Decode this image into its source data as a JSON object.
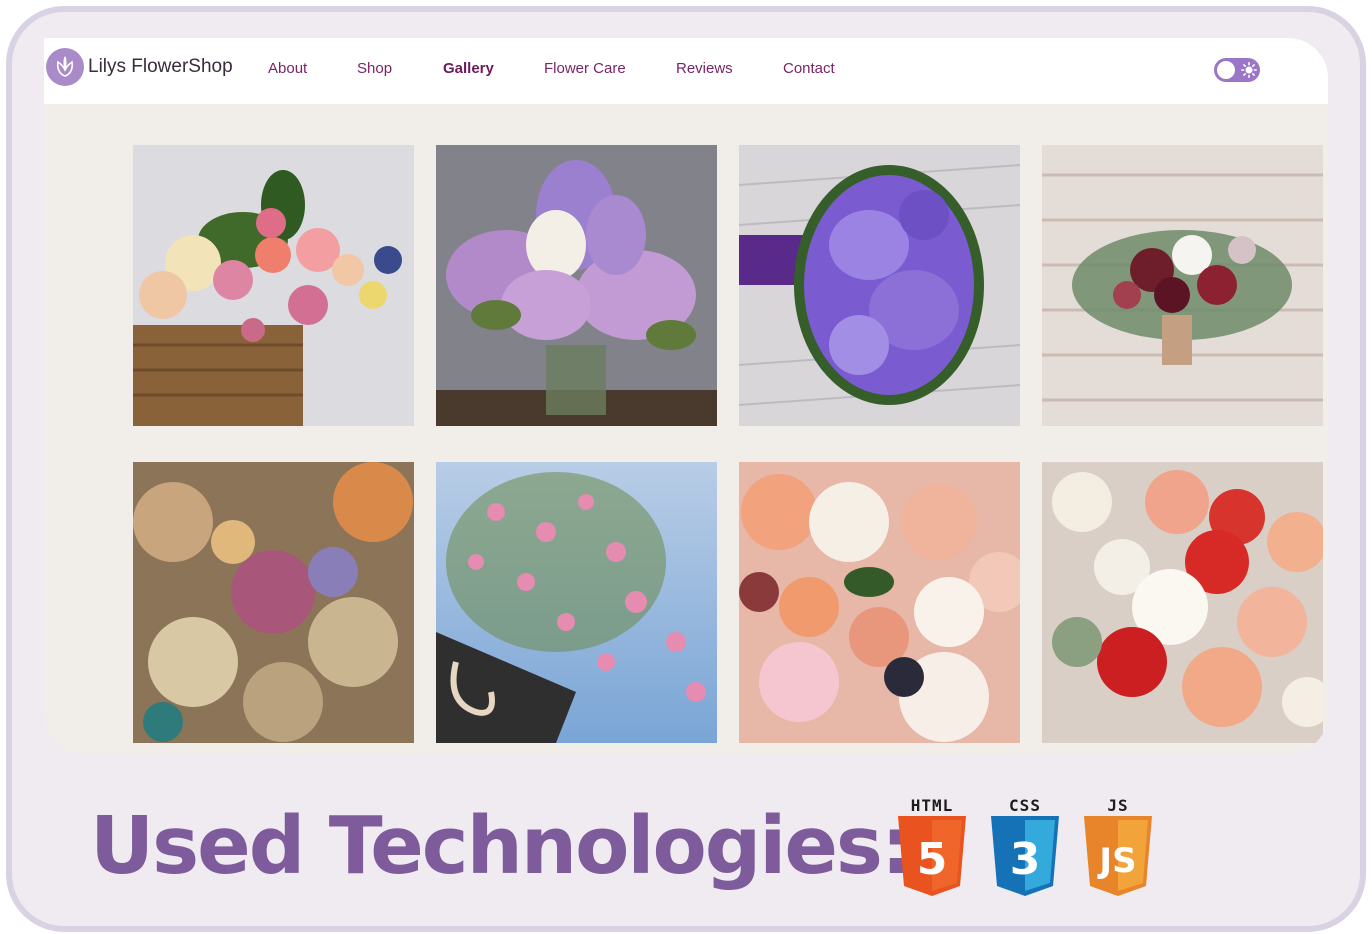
{
  "header": {
    "logo_text": "Lilys FlowerShop",
    "nav": [
      {
        "label": "About"
      },
      {
        "label": "Shop"
      },
      {
        "label": "Gallery",
        "active": true
      },
      {
        "label": "Flower Care"
      },
      {
        "label": "Reviews"
      },
      {
        "label": "Contact"
      }
    ],
    "theme_toggle": {
      "icon": "sun-icon",
      "state": "off"
    }
  },
  "gallery": {
    "images": [
      {
        "name": "rose-basket-image"
      },
      {
        "name": "lilac-vase-image"
      },
      {
        "name": "purple-bouquet-image"
      },
      {
        "name": "burgundy-bouquet-image"
      },
      {
        "name": "dried-flowers-image"
      },
      {
        "name": "gypsophila-bag-image"
      },
      {
        "name": "ranunculus-bouquet-image"
      },
      {
        "name": "red-peony-bouquet-image"
      }
    ]
  },
  "footer": {
    "heading": "Used Technologies:",
    "badges": [
      {
        "caption": "HTML",
        "glyph": "5",
        "color": "#e8531f",
        "shade": "#f0652a"
      },
      {
        "caption": "CSS",
        "glyph": "3",
        "color": "#1572b6",
        "shade": "#33a9dc"
      },
      {
        "caption": "JS",
        "glyph": "JS",
        "color": "#e8842a",
        "shade": "#f2a33a"
      }
    ]
  },
  "colors": {
    "accent": "#7e5b9b",
    "nav_text": "#7a2468",
    "frame": "#d9d2e3",
    "page_bg": "#f1ede8"
  }
}
